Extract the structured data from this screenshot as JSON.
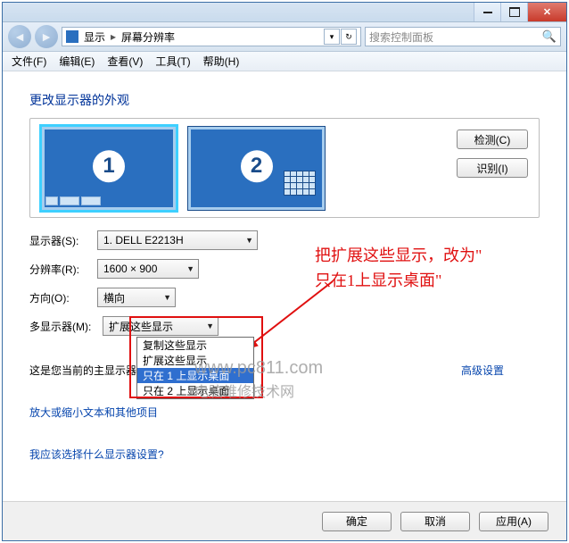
{
  "window": {
    "app_icon": "control-panel",
    "minimize": "最小化",
    "maximize": "最大化",
    "close": "关闭"
  },
  "address": {
    "segment1": "显示",
    "segment2": "屏幕分辨率"
  },
  "search": {
    "placeholder": "搜索控制面板"
  },
  "menu": {
    "file": "文件(F)",
    "edit": "编辑(E)",
    "view": "查看(V)",
    "tools": "工具(T)",
    "help": "帮助(H)"
  },
  "page": {
    "title": "更改显示器的外观"
  },
  "monitors": {
    "m1_label": "1",
    "m2_label": "2",
    "detect_btn": "检测(C)",
    "identify_btn": "识别(I)"
  },
  "form": {
    "display_lbl": "显示器(S):",
    "display_val": "1. DELL E2213H",
    "resolution_lbl": "分辨率(R):",
    "resolution_val": "1600 × 900",
    "orientation_lbl": "方向(O):",
    "orientation_val": "横向",
    "multi_lbl": "多显示器(M):",
    "multi_val": "扩展这些显示",
    "multi_options": [
      "复制这些显示",
      "扩展这些显示",
      "只在 1 上显示桌面",
      "只在 2 上显示桌面"
    ]
  },
  "notes": {
    "primary": "这是您当前的主显示器。",
    "textsize_link": "放大或缩小文本和其他项目",
    "which_link": "我应该选择什么显示器设置?",
    "advanced_link": "高级设置"
  },
  "annotation": {
    "line1": "把扩展这些显示，改为\"",
    "line2": "只在1上显示桌面\""
  },
  "watermark": {
    "l1": "www.pc811.com",
    "l2": "电脑维修技术网"
  },
  "footer": {
    "ok": "确定",
    "cancel": "取消",
    "apply": "应用(A)"
  }
}
